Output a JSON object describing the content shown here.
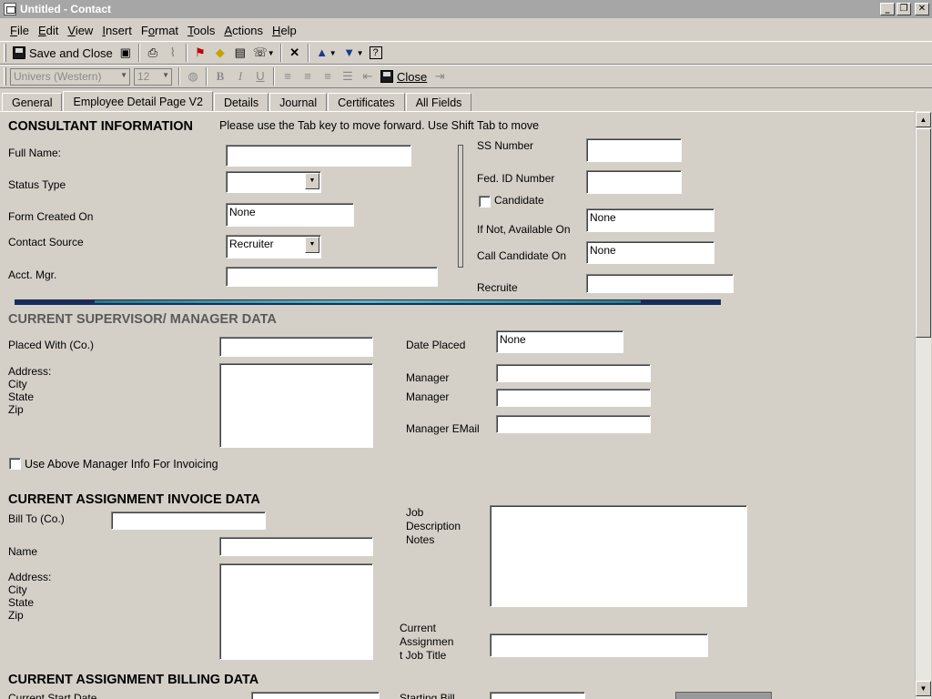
{
  "window": {
    "title": "Untitled - Contact",
    "min": "_",
    "restore": "❐",
    "close": "✕"
  },
  "menu": [
    "File",
    "Edit",
    "View",
    "Insert",
    "Format",
    "Tools",
    "Actions",
    "Help"
  ],
  "menu_underline": [
    "F",
    "E",
    "V",
    "I",
    "o",
    "T",
    "A",
    "H"
  ],
  "toolbar": {
    "save_close_label": "Save and Close",
    "close_label": "Close",
    "font_name": "Univers (Western)",
    "font_size": "12"
  },
  "tabs": [
    "General",
    "Employee Detail Page V2",
    "Details",
    "Journal",
    "Certificates",
    "All Fields"
  ],
  "active_tab": "Employee Detail Page V2",
  "consultant": {
    "heading": "CONSULTANT INFORMATION",
    "instruction": "Please use the Tab key to move forward. Use Shift Tab to move",
    "full_name_label": "Full Name:",
    "full_name": "",
    "status_type_label": "Status Type",
    "status_type": "",
    "form_created_label": "Form Created On",
    "form_created": "None",
    "contact_source_label": "Contact Source",
    "contact_source": "Recruiter",
    "acct_mgr_label": "Acct. Mgr.",
    "acct_mgr": "",
    "ss_label": "SS Number",
    "ss": "",
    "fed_id_label": "Fed. ID Number",
    "fed_id": "",
    "candidate_label": "Candidate Placed",
    "if_not_label": "If Not, Available On",
    "if_not": "None",
    "call_label": "Call Candidate On",
    "call": "None",
    "recruiter_label": "Recruite",
    "recruiter": ""
  },
  "supervisor": {
    "heading": "CURRENT SUPERVISOR/ MANAGER DATA",
    "placed_with_label": "Placed With (Co.)",
    "placed_with": "",
    "address_label": "Address:",
    "city_label": "City",
    "state_label": "State",
    "zip_label": "Zip",
    "date_placed_label": "Date Placed",
    "date_placed": "None",
    "manager1_label": "Manager",
    "manager2_label": "Manager",
    "manager_email_label": "Manager EMail",
    "use_above_label": "Use Above Manager Info For Invoicing"
  },
  "invoice": {
    "heading": "CURRENT ASSIGNMENT INVOICE DATA",
    "bill_to_label": "Bill To (Co.)",
    "bill_to": "",
    "name_label": "Name",
    "name": "",
    "address_label": "Address:",
    "city_label": "City",
    "state_label": "State",
    "zip_label": "Zip",
    "job_desc_label_1": "Job",
    "job_desc_label_2": "Description",
    "job_desc_label_3": "Notes",
    "job_title_label_1": "Current",
    "job_title_label_2": "Assignmen",
    "job_title_label_3": "t Job Title"
  },
  "billing": {
    "heading": "CURRENT ASSIGNMENT BILLING DATA",
    "start_date_label": "Current Start Date",
    "starting_bill_label": "Starting Bill"
  }
}
